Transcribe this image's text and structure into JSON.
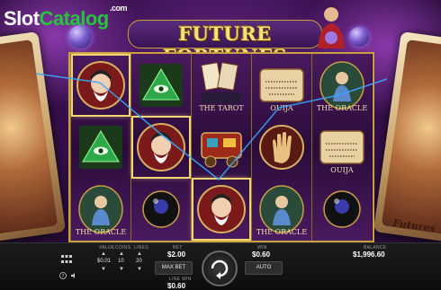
{
  "watermark": {
    "slot": "Slot",
    "catalog": "Catalog",
    "com": ".com"
  },
  "game": {
    "title": "Future Fortunes",
    "title_display": "FUTURE FORTUNES"
  },
  "side_cards": {
    "right_text": "Futures"
  },
  "symbols": {
    "nostradamus": "Nostradamus",
    "eye": "All-Seeing Eye",
    "tarot": "THE TAROT",
    "ouija": "OUIJA",
    "oracle": "THE ORACLE",
    "eight_ball": "8",
    "palm": "Palm",
    "wagon": "Wagon"
  },
  "reels": [
    [
      "nostradamus",
      "eye",
      "oracle"
    ],
    [
      "eye",
      "nostradamus",
      "eight_ball"
    ],
    [
      "tarot",
      "wagon",
      "nostradamus"
    ],
    [
      "ouija",
      "palm",
      "oracle"
    ],
    [
      "oracle",
      "ouija",
      "eight_ball"
    ]
  ],
  "winning_positions": [
    [
      0,
      0
    ],
    [
      1,
      1
    ],
    [
      2,
      2
    ]
  ],
  "controls": {
    "value_label": "VALUE",
    "value": "$0.01",
    "coins_label": "COINS",
    "coins": "10",
    "lines_label": "LINES",
    "lines": "20",
    "bet_label": "BET",
    "bet": "$2.00",
    "max_bet": "MAX BET",
    "line_win_label": "LINE WIN",
    "line_win": "$0.60",
    "win_label": "WIN",
    "win": "$0.60",
    "auto": "AUTO",
    "balance_label": "BALANCE",
    "balance": "$1,996.60"
  },
  "colors": {
    "accent_gold": "#c9a040",
    "logo_green": "#27c23f",
    "payline_blue": "#3aa6ff"
  }
}
